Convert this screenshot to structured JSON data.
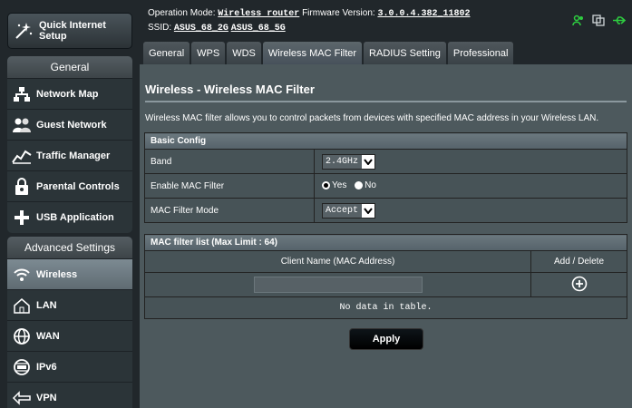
{
  "sidebar": {
    "quick_setup_label": "Quick Internet Setup",
    "general_header": "General",
    "general_items": [
      {
        "label": "Network Map",
        "icon": "network-map-icon"
      },
      {
        "label": "Guest Network",
        "icon": "guest-network-icon"
      },
      {
        "label": "Traffic Manager",
        "icon": "traffic-manager-icon"
      },
      {
        "label": "Parental Controls",
        "icon": "parental-controls-icon"
      },
      {
        "label": "USB Application",
        "icon": "usb-application-icon"
      }
    ],
    "advanced_header": "Advanced Settings",
    "advanced_items": [
      {
        "label": "Wireless",
        "icon": "wireless-icon",
        "active": true
      },
      {
        "label": "LAN",
        "icon": "lan-icon"
      },
      {
        "label": "WAN",
        "icon": "wan-icon"
      },
      {
        "label": "IPv6",
        "icon": "ipv6-icon"
      },
      {
        "label": "VPN",
        "icon": "vpn-icon"
      }
    ]
  },
  "topbar": {
    "operation_mode_label": "Operation Mode:",
    "operation_mode_value": "Wireless router",
    "firmware_label": "Firmware Version:",
    "firmware_value": "3.0.0.4.382_11802",
    "ssid_label": "SSID:",
    "ssid_2g": "ASUS_68_2G",
    "ssid_5g": "ASUS_68_5G",
    "icons": [
      "users-icon",
      "copy-icon",
      "usb-icon"
    ]
  },
  "tabs": [
    "General",
    "WPS",
    "WDS",
    "Wireless MAC Filter",
    "RADIUS Setting",
    "Professional"
  ],
  "active_tab": "Wireless MAC Filter",
  "main": {
    "title": "Wireless - Wireless MAC Filter",
    "description": "Wireless MAC filter allows you to control packets from devices with specified MAC address in your Wireless LAN.",
    "basic_config_header": "Basic Config",
    "band_label": "Band",
    "band_value": "2.4GHz",
    "enable_label": "Enable MAC Filter",
    "enable_yes": "Yes",
    "enable_no": "No",
    "enable_selected": "Yes",
    "mode_label": "MAC Filter Mode",
    "mode_value": "Accept",
    "list_header": "MAC filter list (Max Limit : 64)",
    "col_client": "Client Name (MAC Address)",
    "col_action": "Add / Delete",
    "mac_input_value": "",
    "no_data": "No data in table.",
    "apply_label": "Apply"
  },
  "colors": {
    "accent_green": "#2ecc40",
    "nodata_text": "#ffcc00"
  }
}
